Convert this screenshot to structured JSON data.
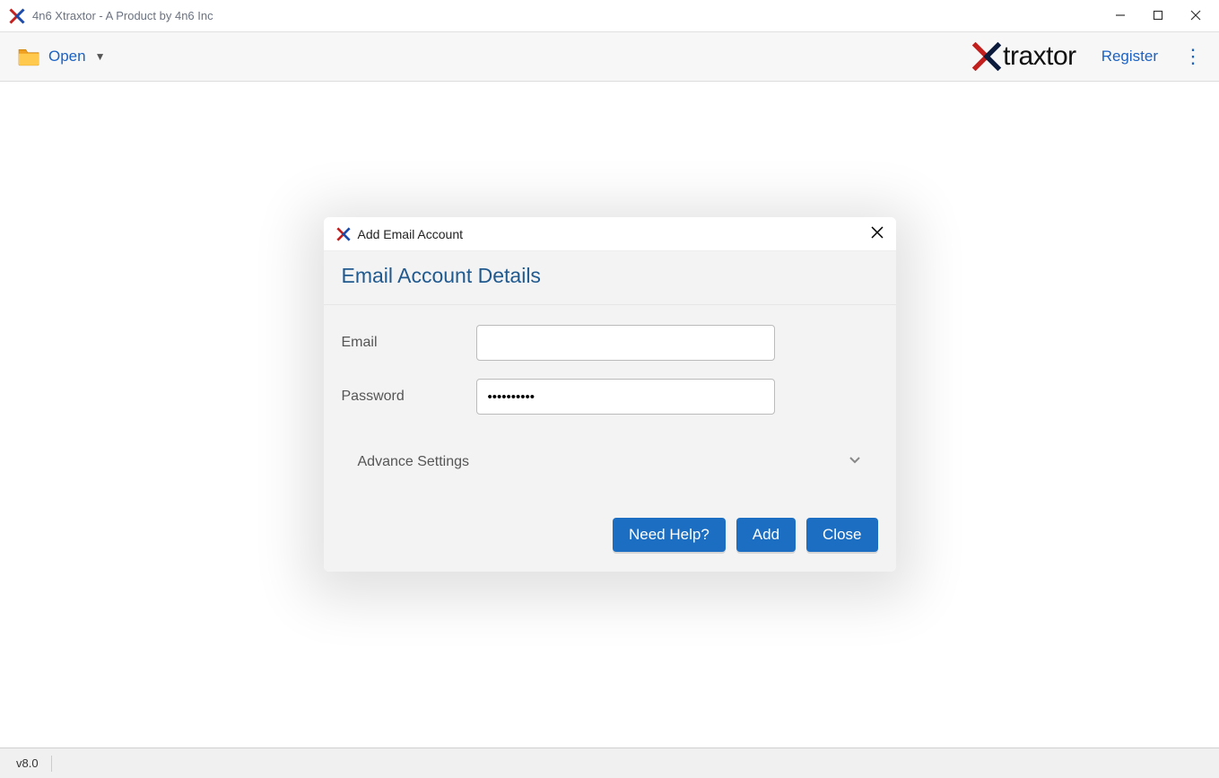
{
  "window": {
    "title": "4n6 Xtraxtor - A Product by 4n6 Inc"
  },
  "toolbar": {
    "open_label": "Open",
    "brand_text": "traxtor",
    "register_label": "Register"
  },
  "dialog": {
    "title": "Add Email Account",
    "heading": "Email Account Details",
    "email_label": "Email",
    "email_value": "",
    "password_label": "Password",
    "password_value": "••••••••••",
    "advance_label": "Advance Settings",
    "need_help_label": "Need Help?",
    "add_label": "Add",
    "close_label": "Close"
  },
  "statusbar": {
    "version": "v8.0"
  }
}
